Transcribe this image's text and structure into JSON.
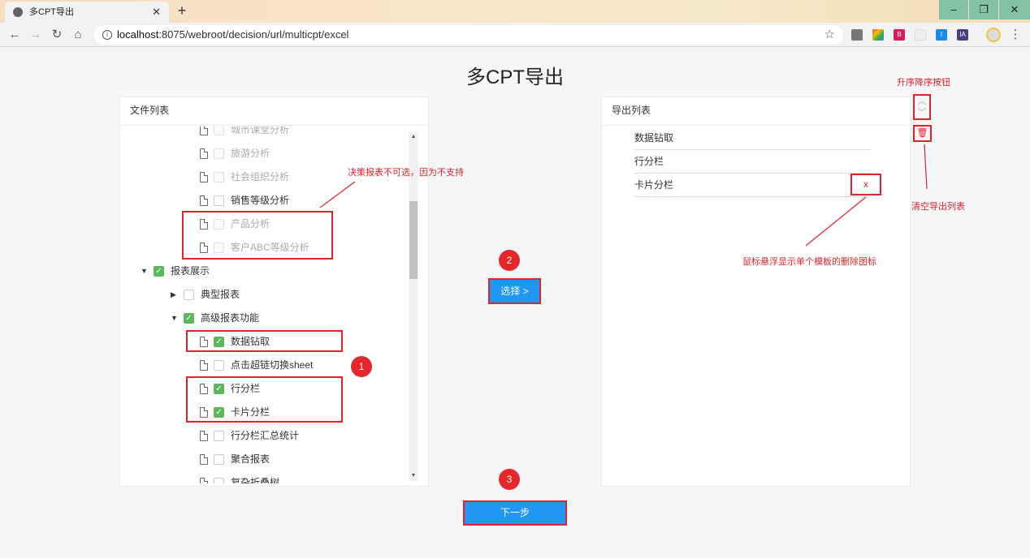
{
  "browser": {
    "tab_title": "多CPT导出",
    "tab_close": "✕",
    "new_tab": "+",
    "url_host": "localhost",
    "url_rest": ":8075/webroot/decision/url/multicpt/excel",
    "window_controls": [
      "–",
      "❐",
      "✕"
    ],
    "extensions": [
      "B",
      "I",
      "I",
      "IA"
    ]
  },
  "page": {
    "title": "多CPT导出"
  },
  "file_panel": {
    "header": "文件列表",
    "rows": [
      {
        "label": "城市课堂分析",
        "type": "file",
        "checkbox": "disabled"
      },
      {
        "label": "旅游分析",
        "type": "file",
        "checkbox": "disabled"
      },
      {
        "label": "社会组织分析",
        "type": "file",
        "checkbox": "disabled"
      },
      {
        "label": "销售等级分析",
        "type": "file",
        "checkbox": "unchecked"
      },
      {
        "label": "产品分析",
        "type": "file",
        "checkbox": "disabled"
      },
      {
        "label": "客户ABC等级分析",
        "type": "file",
        "checkbox": "disabled"
      },
      {
        "label": "报表展示",
        "type": "folder-open",
        "checkbox": "checked"
      },
      {
        "label": "典型报表",
        "type": "folder-closed",
        "checkbox": "unchecked"
      },
      {
        "label": "高级报表功能",
        "type": "folder-open",
        "checkbox": "checked"
      },
      {
        "label": "数据钻取",
        "type": "file",
        "checkbox": "checked"
      },
      {
        "label": "点击超链切换sheet",
        "type": "file",
        "checkbox": "unchecked"
      },
      {
        "label": "行分栏",
        "type": "file",
        "checkbox": "checked"
      },
      {
        "label": "卡片分栏",
        "type": "file",
        "checkbox": "checked"
      },
      {
        "label": "行分栏汇总统计",
        "type": "file",
        "checkbox": "unchecked"
      },
      {
        "label": "聚合报表",
        "type": "file",
        "checkbox": "unchecked"
      },
      {
        "label": "复杂折叠树",
        "type": "file",
        "checkbox": "unchecked"
      }
    ]
  },
  "export_panel": {
    "header": "导出列表",
    "items": [
      "数据钻取",
      "行分栏",
      "卡片分栏"
    ],
    "delete_label": "x"
  },
  "buttons": {
    "select": "选择 >",
    "next": "下一步"
  },
  "annotations": {
    "note_unselectable": "决策报表不可选，因为不支持",
    "note_sort": "升序降序按钮",
    "note_clear": "清空导出列表",
    "note_delete": "鼠标悬浮显示单个模板的删除图标",
    "step1": "1",
    "step2": "2",
    "step3": "3"
  },
  "colors": {
    "primary_blue": "#2196f3",
    "annotation_red": "#e0232a",
    "checkbox_green": "#5cb85c"
  }
}
